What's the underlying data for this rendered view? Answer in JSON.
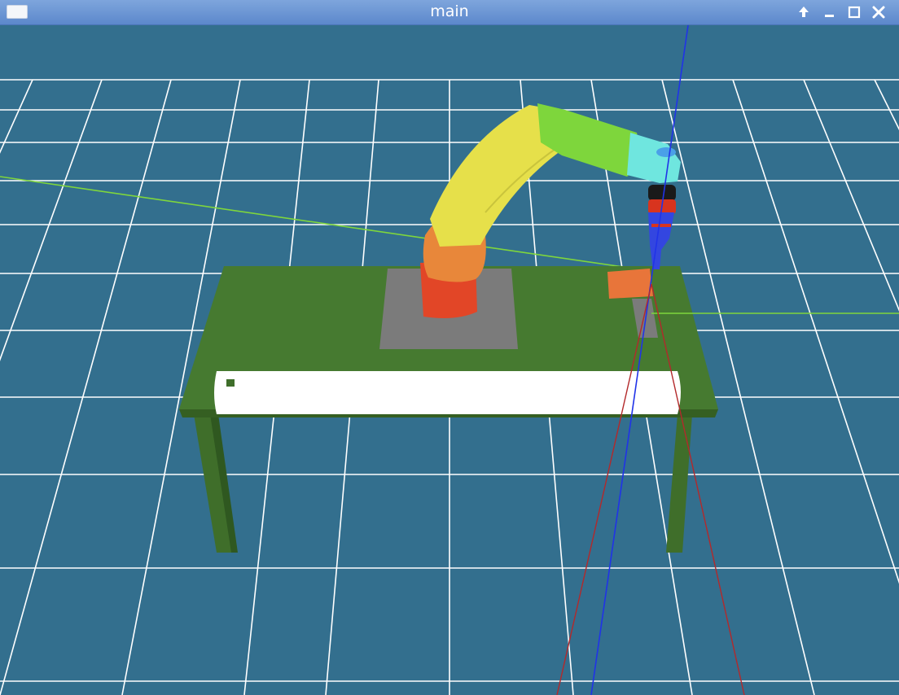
{
  "window": {
    "title": "main",
    "controls": [
      {
        "name": "shade-button",
        "icon": "arrow-up-icon"
      },
      {
        "name": "minimize-button",
        "icon": "minimize-icon"
      },
      {
        "name": "maximize-button",
        "icon": "maximize-icon"
      },
      {
        "name": "close-button",
        "icon": "close-icon"
      }
    ]
  },
  "scene": {
    "background_color": "#336f8e",
    "grid_color": "#ffffff",
    "table_color": "#467a30",
    "robot_colors": {
      "base": "#e24627",
      "shoulder": "#e8873a",
      "upper_arm": "#e6e04a",
      "forearm": "#7ed63c",
      "wrist": "#6fe6df",
      "tool": "#3346e0"
    },
    "axis_colors": {
      "x": "#b3292b",
      "y": "#7fd63c",
      "z": "#2033e8"
    }
  }
}
